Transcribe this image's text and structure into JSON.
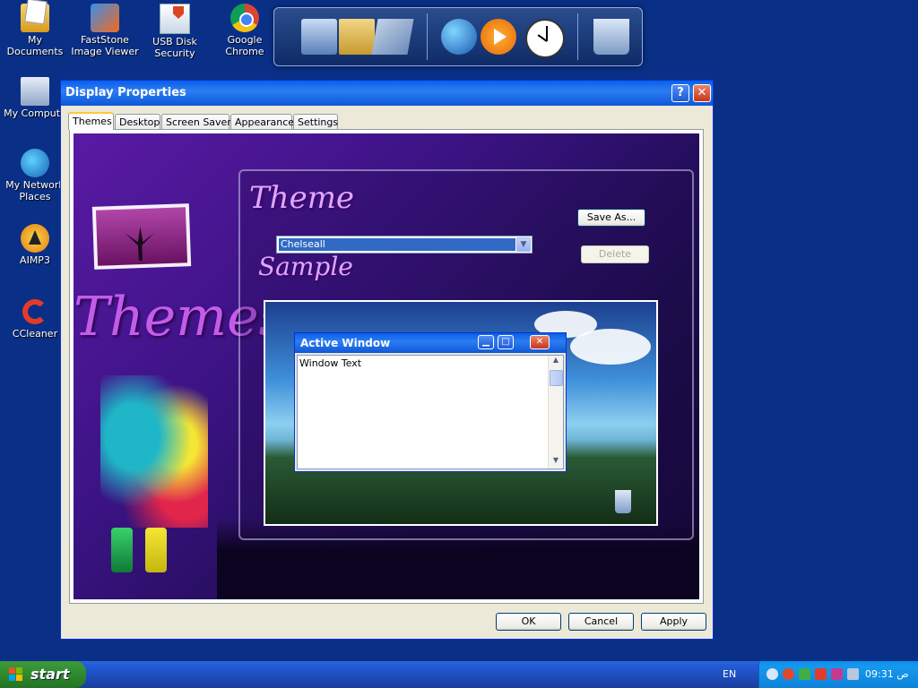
{
  "desktop": {
    "icons": [
      {
        "label": "My Documents"
      },
      {
        "label": "FastStone\nImage Viewer"
      },
      {
        "label": "USB Disk\nSecurity"
      },
      {
        "label": "Google Chrome"
      },
      {
        "label": "My Compute"
      },
      {
        "label": "My Network\nPlaces"
      },
      {
        "label": "AIMP3"
      },
      {
        "label": "CCleaner"
      }
    ],
    "dock_icons": [
      "computer-icon",
      "folder-icon",
      "control-panel-icon",
      "globe-icon",
      "media-player-icon",
      "clock-icon",
      "recycle-bin-icon"
    ]
  },
  "dialog": {
    "title": "Display Properties",
    "help_glyph": "?",
    "close_glyph": "✕",
    "tabs": [
      {
        "label": "Themes",
        "active": true
      },
      {
        "label": "Desktop"
      },
      {
        "label": "Screen Saver"
      },
      {
        "label": "Appearance"
      },
      {
        "label": "Settings"
      }
    ],
    "theme_panel": {
      "heading_theme": "Theme",
      "heading_sample": "Sample",
      "art_text": "Themes",
      "theme_select": {
        "value": "Chelseall"
      },
      "save_as_label": "Save As...",
      "delete_label": "Delete",
      "sample_window": {
        "title": "Active Window",
        "body_text": "Window Text",
        "min_glyph": "▁",
        "max_glyph": "□",
        "close_glyph": "✕"
      }
    },
    "buttons": {
      "ok": "OK",
      "cancel": "Cancel",
      "apply": "Apply"
    }
  },
  "taskbar": {
    "start_label": "start",
    "language": "EN",
    "clock": "09:31 ص"
  },
  "colors": {
    "desktop_bg": "#0a2f86",
    "titlebar": "#0a5fe8",
    "selection": "#316ac5"
  }
}
